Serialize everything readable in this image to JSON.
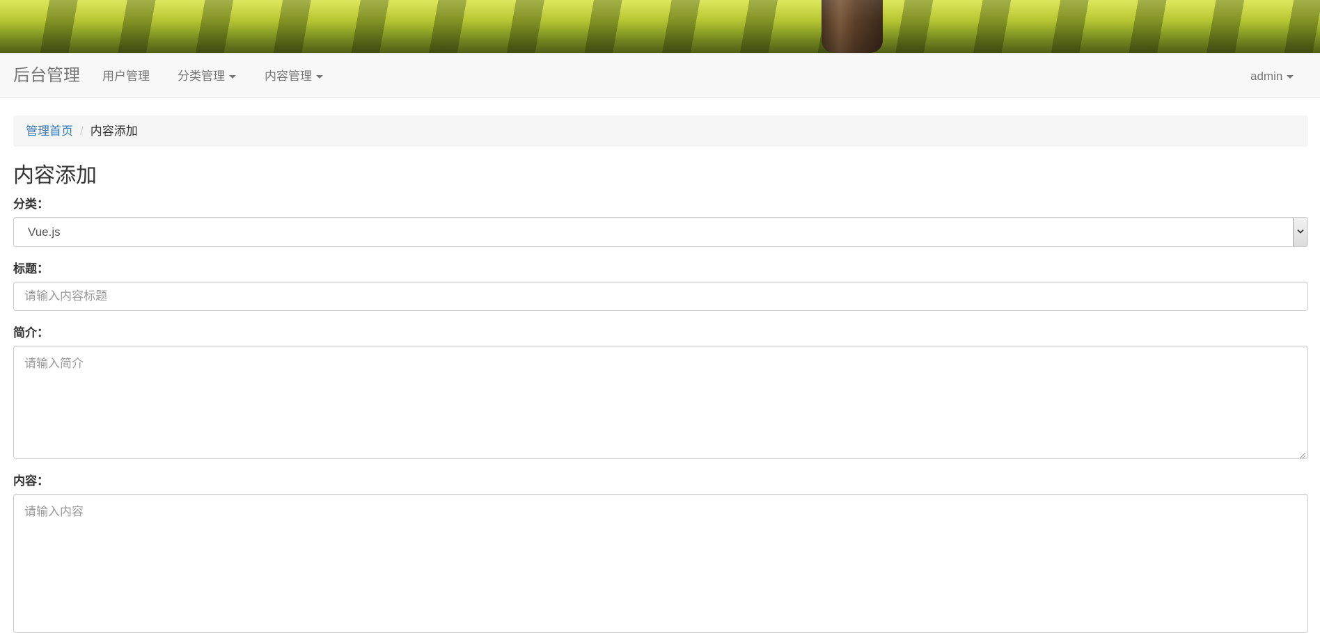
{
  "navbar": {
    "brand": "后台管理",
    "items": [
      {
        "label": "用户管理",
        "dropdown": false
      },
      {
        "label": "分类管理",
        "dropdown": true
      },
      {
        "label": "内容管理",
        "dropdown": true
      }
    ],
    "user": {
      "label": "admin",
      "dropdown": true
    }
  },
  "breadcrumb": {
    "home": "管理首页",
    "separator": "/",
    "current": "内容添加"
  },
  "page": {
    "title": "内容添加"
  },
  "form": {
    "category": {
      "label": "分类：",
      "value": "Vue.js"
    },
    "title": {
      "label": "标题：",
      "placeholder": "请输入内容标题",
      "value": ""
    },
    "summary": {
      "label": "简介：",
      "placeholder": "请输入简介",
      "value": ""
    },
    "content": {
      "label": "内容：",
      "placeholder": "请输入内容",
      "value": ""
    }
  },
  "colors": {
    "navbar_bg": "#f8f8f8",
    "link": "#337ab7",
    "breadcrumb_bg": "#f5f5f5",
    "input_border": "#cccccc",
    "placeholder": "#999999"
  }
}
